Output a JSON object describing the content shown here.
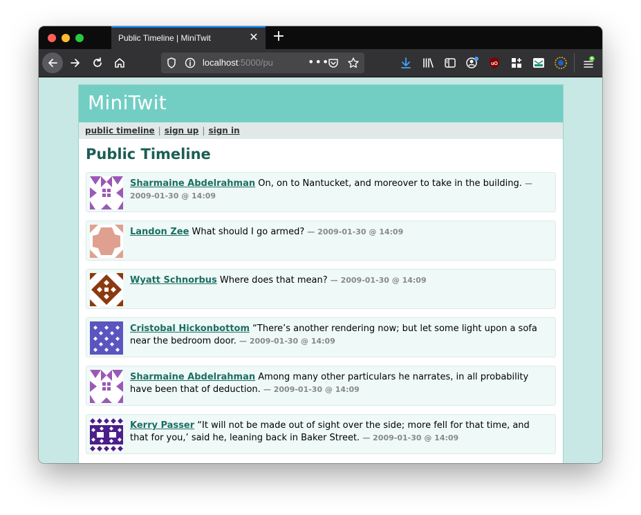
{
  "browser": {
    "tab_title": "Public Timeline | MiniTwit",
    "url_host": "localhost",
    "url_rest": ":5000/pu"
  },
  "site": {
    "title": "MiniTwit",
    "nav": {
      "public_timeline": "public timeline",
      "sign_up": "sign up",
      "sign_in": "sign in",
      "separator": "|"
    },
    "heading": "Public Timeline"
  },
  "messages": [
    {
      "user": "Sharmaine Abdelrahman",
      "text": "On, on to Nantucket, and moreover to take in the building.",
      "date": "— 2009-01-30 @ 14:09",
      "avatar_color": "#9b59b6"
    },
    {
      "user": "Landon Zee",
      "text": "What should I go armed?",
      "date": "— 2009-01-30 @ 14:09",
      "avatar_color": "#e0a090"
    },
    {
      "user": "Wyatt Schnorbus",
      "text": "Where does that mean?",
      "date": "— 2009-01-30 @ 14:09",
      "avatar_color": "#8b3a0f"
    },
    {
      "user": "Cristobal Hickonbottom",
      "text": "“There’s another rendering now; but let some light upon a sofa near the bedroom door.",
      "date": "— 2009-01-30 @ 14:09",
      "avatar_color": "#5b55c0"
    },
    {
      "user": "Sharmaine Abdelrahman",
      "text": "Among many other particulars he narrates, in all probability have been that of deduction.",
      "date": "— 2009-01-30 @ 14:09",
      "avatar_color": "#9b59b6"
    },
    {
      "user": "Kerry Passer",
      "text": "“It will not be made out of sight over the side; more fell for that time, and that for you,’ said he, leaning back in Baker Street.",
      "date": "— 2009-01-30 @ 14:09",
      "avatar_color": "#4a1f8a"
    }
  ]
}
